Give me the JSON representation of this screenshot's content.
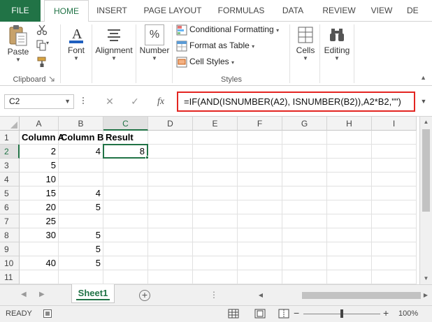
{
  "tabs": [
    "FILE",
    "HOME",
    "INSERT",
    "PAGE LAYOUT",
    "FORMULAS",
    "DATA",
    "REVIEW",
    "VIEW",
    "DE"
  ],
  "active_tab": "HOME",
  "ribbon": {
    "clipboard": {
      "label": "Clipboard",
      "paste": "Paste"
    },
    "font": {
      "label": "Font"
    },
    "alignment": {
      "label": "Alignment"
    },
    "number": {
      "label": "Number",
      "symbol": "%"
    },
    "styles": {
      "label": "Styles",
      "conditional_formatting": "Conditional Formatting",
      "format_as_table": "Format as Table",
      "cell_styles": "Cell Styles"
    },
    "cells": {
      "label": "Cells"
    },
    "editing": {
      "label": "Editing"
    }
  },
  "formula_bar": {
    "name_box": "C2",
    "fx": "fx",
    "formula": "=IF(AND(ISNUMBER(A2), ISNUMBER(B2)),A2*B2,\"\")"
  },
  "grid": {
    "columns": [
      "A",
      "B",
      "C",
      "D",
      "E",
      "F",
      "G",
      "H",
      "I"
    ],
    "rows": [
      "1",
      "2",
      "3",
      "4",
      "5",
      "6",
      "7",
      "8",
      "9",
      "10",
      "11"
    ],
    "header_row": [
      "Column A",
      "Column B",
      "Result"
    ],
    "data": [
      [
        "2",
        "4",
        "8"
      ],
      [
        "5",
        "",
        ""
      ],
      [
        "10",
        "",
        ""
      ],
      [
        "15",
        "4",
        ""
      ],
      [
        "20",
        "5",
        ""
      ],
      [
        "25",
        "",
        ""
      ],
      [
        "30",
        "5",
        ""
      ],
      [
        "",
        "5",
        ""
      ],
      [
        "40",
        "5",
        ""
      ],
      [
        "",
        "",
        ""
      ]
    ],
    "active_cell": "C2"
  },
  "sheets": [
    "Sheet1"
  ],
  "status": {
    "mode": "READY",
    "zoom": "100%",
    "zoom_level": 1.0
  },
  "colors": {
    "accent": "#217346",
    "highlight_border": "#e32521"
  }
}
